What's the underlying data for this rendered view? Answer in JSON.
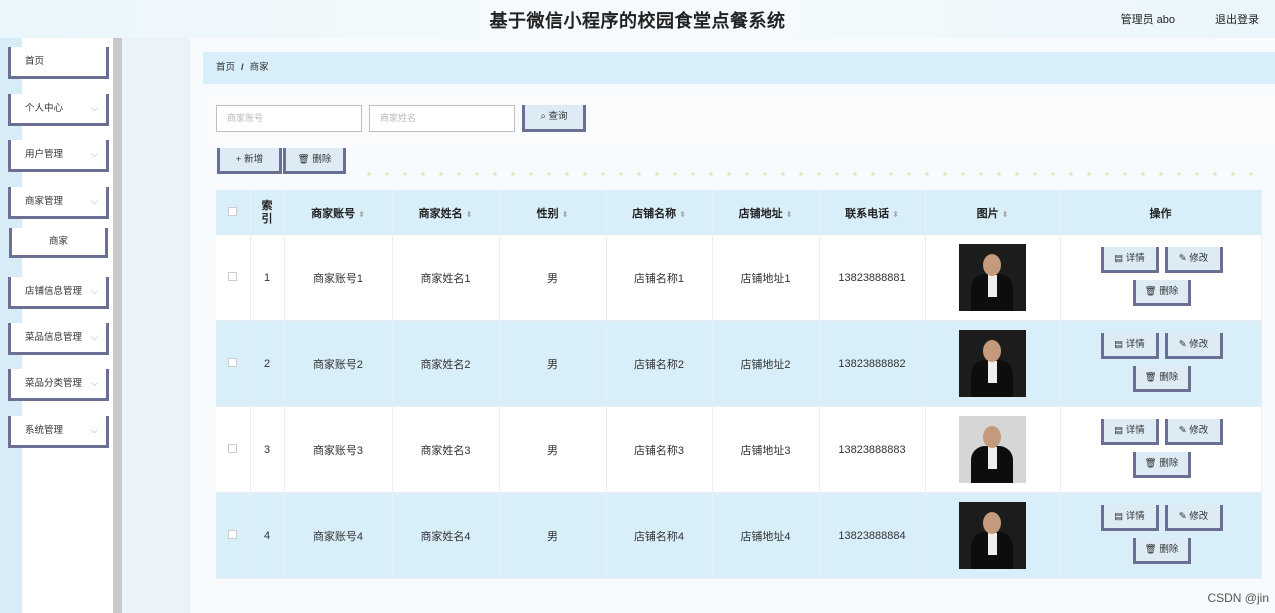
{
  "header": {
    "title": "基于微信小程序的校园食堂点餐系统",
    "user": "管理员 abo",
    "logout": "退出登录"
  },
  "sidebar": {
    "items": [
      {
        "label": "首页"
      },
      {
        "label": "个人中心"
      },
      {
        "label": "用户管理"
      },
      {
        "label": "商家管理"
      },
      {
        "label": "商家"
      },
      {
        "label": "店铺信息管理"
      },
      {
        "label": "菜品信息管理"
      },
      {
        "label": "菜品分类管理"
      },
      {
        "label": "系统管理"
      }
    ]
  },
  "breadcrumb": {
    "home": "首页",
    "sep": "/",
    "current": "商家"
  },
  "search": {
    "account_placeholder": "商家账号",
    "name_placeholder": "商家姓名",
    "query_label": "查询"
  },
  "actions": {
    "add_label": "新增",
    "delete_label": "删除"
  },
  "table": {
    "headers": [
      "索\n引",
      "商家账号",
      "商家姓名",
      "性别",
      "店铺名称",
      "店铺地址",
      "联系电话",
      "图片",
      "操作"
    ],
    "rows": [
      {
        "index": "1",
        "account": "商家账号1",
        "name": "商家姓名1",
        "gender": "男",
        "shop": "店铺名称1",
        "address": "店铺地址1",
        "phone": "13823888881"
      },
      {
        "index": "2",
        "account": "商家账号2",
        "name": "商家姓名2",
        "gender": "男",
        "shop": "店铺名称2",
        "address": "店铺地址2",
        "phone": "13823888882"
      },
      {
        "index": "3",
        "account": "商家账号3",
        "name": "商家姓名3",
        "gender": "男",
        "shop": "店铺名称3",
        "address": "店铺地址3",
        "phone": "13823888883"
      },
      {
        "index": "4",
        "account": "商家账号4",
        "name": "商家姓名4",
        "gender": "男",
        "shop": "店铺名称4",
        "address": "店铺地址4",
        "phone": "13823888884"
      }
    ],
    "ops": {
      "detail": "详情",
      "edit": "修改",
      "delete": "删除"
    }
  },
  "watermark": "CSDN @jin"
}
